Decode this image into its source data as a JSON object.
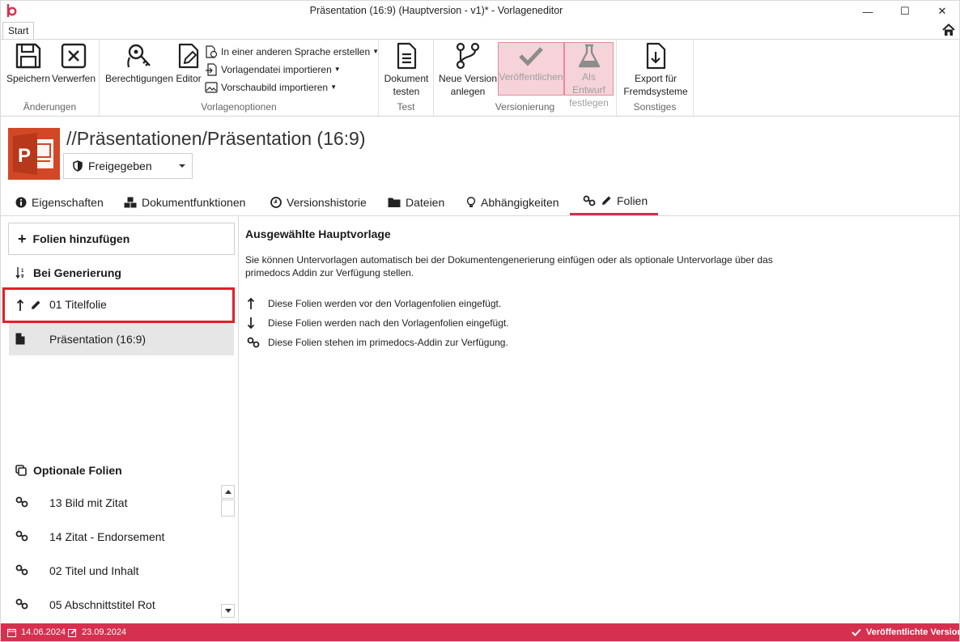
{
  "window": {
    "title": "Präsentation (16:9) (Hauptversion - v1)* - Vorlageneditor",
    "minimize": "—",
    "maximize": "☐",
    "close": "✕"
  },
  "ribbon_tabs": {
    "start": "Start"
  },
  "ribbon": {
    "groups": {
      "changes": "Änderungen",
      "template_options": "Vorlagenoptionen",
      "test": "Test",
      "versioning": "Versionierung",
      "other": "Sonstiges"
    },
    "save": "Speichern",
    "discard": "Verwerfen",
    "permissions": "Berechtigungen",
    "editor": "Editor",
    "create_other_language": "In einer anderen Sprache erstellen",
    "import_template_file": "Vorlagendatei importieren",
    "import_preview": "Vorschaubild importieren",
    "test_document_line1": "Dokument",
    "test_document_line2": "testen",
    "new_version_line1": "Neue Version",
    "new_version_line2": "anlegen",
    "publish": "Veröffentlichen",
    "draft_line1": "Als Entwurf",
    "draft_line2": "festlegen",
    "export_line1": "Export für",
    "export_line2": "Fremdsysteme"
  },
  "header": {
    "path": "//Präsentationen/Präsentation (16:9)",
    "status": "Freigegeben"
  },
  "nav_tabs": {
    "properties": "Eigenschaften",
    "doc_functions": "Dokumentfunktionen",
    "version_history": "Versionshistorie",
    "files": "Dateien",
    "dependencies": "Abhängigkeiten",
    "slides": "Folien"
  },
  "left": {
    "add_slides": "Folien hinzufügen",
    "on_generation": "Bei Generierung",
    "generation_items": [
      {
        "label": "01 Titelfolie"
      },
      {
        "label": "Präsentation (16:9)"
      }
    ],
    "optional_slides": "Optionale Folien",
    "optional_items": [
      {
        "label": "13 Bild mit Zitat"
      },
      {
        "label": "14 Zitat - Endorsement"
      },
      {
        "label": "02 Titel und Inhalt"
      },
      {
        "label": "05 Abschnittstitel Rot"
      }
    ]
  },
  "content": {
    "heading": "Ausgewählte Hauptvorlage",
    "description": "Sie können Untervorlagen automatisch bei der Dokumentengenerierung einfügen oder als optionale Untervorlage über das primedocs Addin zur Verfügung stellen.",
    "legend": {
      "before": "Diese Folien werden vor den Vorlagenfolien eingefügt.",
      "after": "Diese Folien werden nach den Vorlagenfolien eingefügt.",
      "addin": "Diese Folien stehen im primedocs-Addin zur Verfügung."
    }
  },
  "statusbar": {
    "created": "14.06.2024",
    "modified": "23.09.2024",
    "published": "Veröffentlichte Version"
  },
  "colors": {
    "accent": "#d6304f",
    "powerpoint": "#d24726",
    "highlight_border": "#e0202a"
  }
}
